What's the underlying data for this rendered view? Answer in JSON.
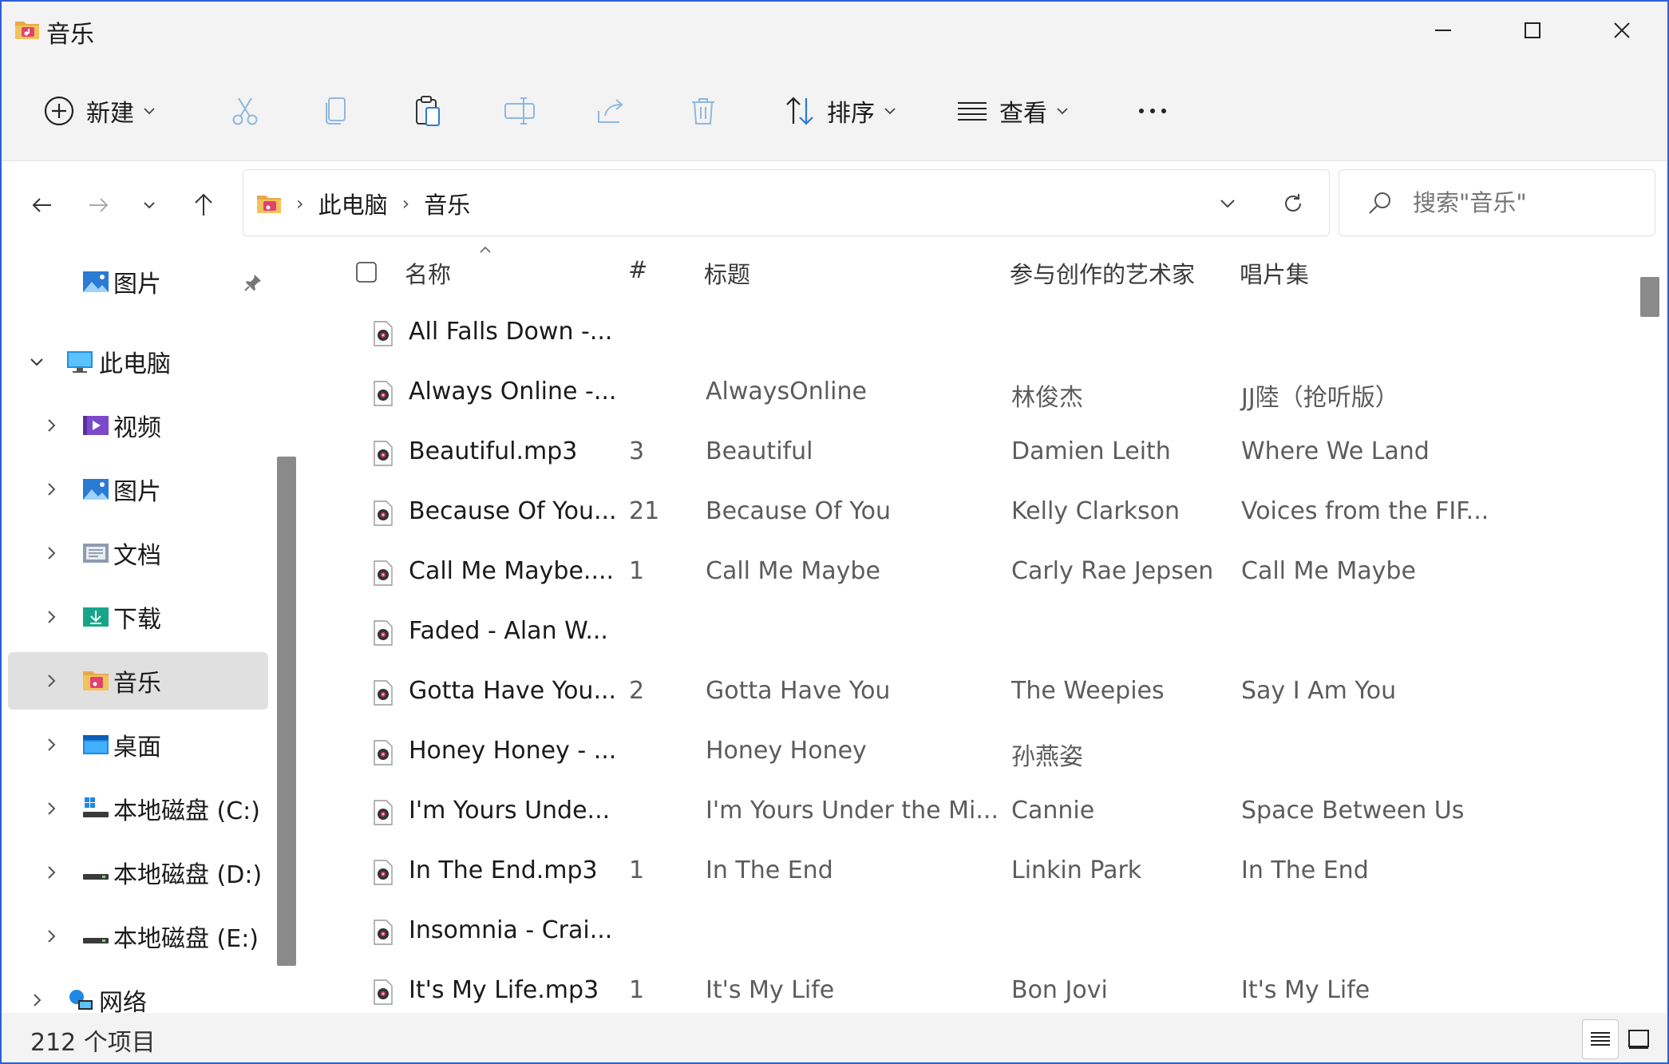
{
  "window": {
    "title": "音乐"
  },
  "toolbar": {
    "new_label": "新建",
    "sort_label": "排序",
    "view_label": "查看"
  },
  "address": {
    "crumbs": [
      "此电脑",
      "音乐"
    ]
  },
  "search": {
    "placeholder": "搜索\"音乐\""
  },
  "sidebar": {
    "items": [
      {
        "label": "图片",
        "icon": "pictures-icon",
        "pinned": true
      },
      {
        "label": "此电脑",
        "icon": "computer-icon",
        "expanded": true
      },
      {
        "label": "视频",
        "icon": "videos-icon"
      },
      {
        "label": "图片",
        "icon": "pictures-icon"
      },
      {
        "label": "文档",
        "icon": "documents-icon"
      },
      {
        "label": "下载",
        "icon": "downloads-icon"
      },
      {
        "label": "音乐",
        "icon": "music-folder-icon",
        "selected": true
      },
      {
        "label": "桌面",
        "icon": "desktop-icon"
      },
      {
        "label": "本地磁盘 (C:)",
        "icon": "windows-drive-icon"
      },
      {
        "label": "本地磁盘 (D:)",
        "icon": "drive-icon"
      },
      {
        "label": "本地磁盘 (E:)",
        "icon": "drive-icon"
      },
      {
        "label": "网络",
        "icon": "network-icon"
      }
    ]
  },
  "columns": {
    "name": "名称",
    "track": "#",
    "title": "标题",
    "artists": "参与创作的艺术家",
    "album": "唱片集"
  },
  "files": [
    {
      "name": "All Falls Down -...",
      "track": "",
      "title": "",
      "artist": "",
      "album": ""
    },
    {
      "name": "Always Online -...",
      "track": "",
      "title": "AlwaysOnline",
      "artist": "林俊杰",
      "album": "JJ陸（抢听版）"
    },
    {
      "name": "Beautiful.mp3",
      "track": "3",
      "title": "Beautiful",
      "artist": "Damien Leith",
      "album": "Where We Land"
    },
    {
      "name": "Because Of You...",
      "track": "21",
      "title": "Because Of You",
      "artist": "Kelly Clarkson",
      "album": "Voices from the FIF..."
    },
    {
      "name": "Call Me Maybe....",
      "track": "1",
      "title": "Call Me Maybe",
      "artist": "Carly Rae Jepsen",
      "album": "Call Me Maybe"
    },
    {
      "name": "Faded - Alan W...",
      "track": "",
      "title": "",
      "artist": "",
      "album": ""
    },
    {
      "name": "Gotta Have You...",
      "track": "2",
      "title": "Gotta Have You",
      "artist": "The Weepies",
      "album": "Say I Am You"
    },
    {
      "name": "Honey Honey - ...",
      "track": "",
      "title": "Honey Honey",
      "artist": "孙燕姿",
      "album": ""
    },
    {
      "name": "I'm Yours Unde...",
      "track": "",
      "title": "I'm Yours Under the Mi...",
      "artist": "Cannie",
      "album": "Space Between Us"
    },
    {
      "name": "In The End.mp3",
      "track": "1",
      "title": "In The End",
      "artist": "Linkin Park",
      "album": "In The End"
    },
    {
      "name": "Insomnia - Crai...",
      "track": "",
      "title": "",
      "artist": "",
      "album": ""
    },
    {
      "name": "It's My Life.mp3",
      "track": "1",
      "title": "It's My Life",
      "artist": "Bon Jovi",
      "album": "It's My Life"
    }
  ],
  "status": {
    "item_count": "212 个项目"
  }
}
